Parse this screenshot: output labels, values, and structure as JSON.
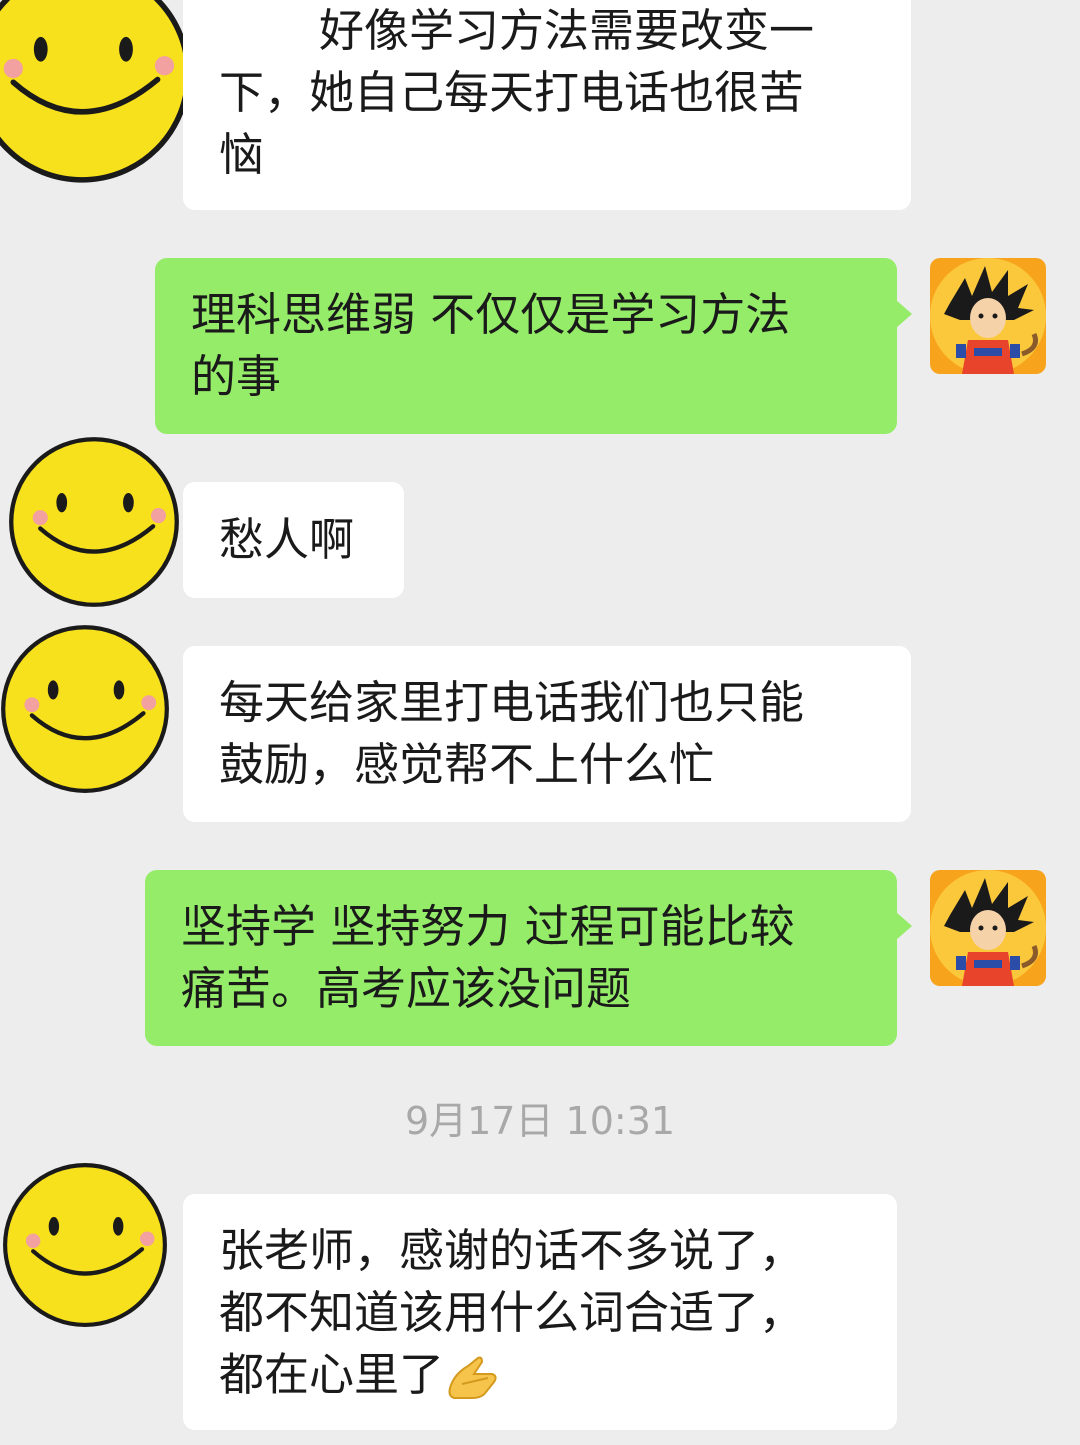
{
  "messages": [
    {
      "side": "in",
      "lines": [
        "好像学习方法需要改变一",
        "下，她自己每天打电话也很苦",
        "恼"
      ]
    },
    {
      "side": "out",
      "lines": [
        "理科思维弱 不仅仅是学习方法",
        "的事"
      ]
    },
    {
      "side": "in",
      "lines": [
        "愁人啊"
      ]
    },
    {
      "side": "in",
      "lines": [
        "每天给家里打电话我们也只能",
        "鼓励，感觉帮不上什么忙"
      ]
    },
    {
      "side": "out",
      "lines": [
        "坚持学 坚持努力 过程可能比较",
        "痛苦。高考应该没问题"
      ]
    },
    {
      "side": "in",
      "lines": [
        "张老师，感谢的话不多说了，",
        "都不知道该用什么词合适了，",
        "都在心里了"
      ],
      "trailing_icon": "folded-hands-emoji"
    }
  ],
  "timestamp": "9月17日 10:31",
  "colors": {
    "background": "#ededed",
    "incoming_bubble": "#ffffff",
    "outgoing_bubble": "#95ec69",
    "smiley_face": "#f7e01c",
    "timestamp_text": "#a8a8a8"
  },
  "icons": {
    "incoming_avatar": "smiley-face-icon",
    "outgoing_avatar": "cartoon-boy-avatar-icon"
  }
}
